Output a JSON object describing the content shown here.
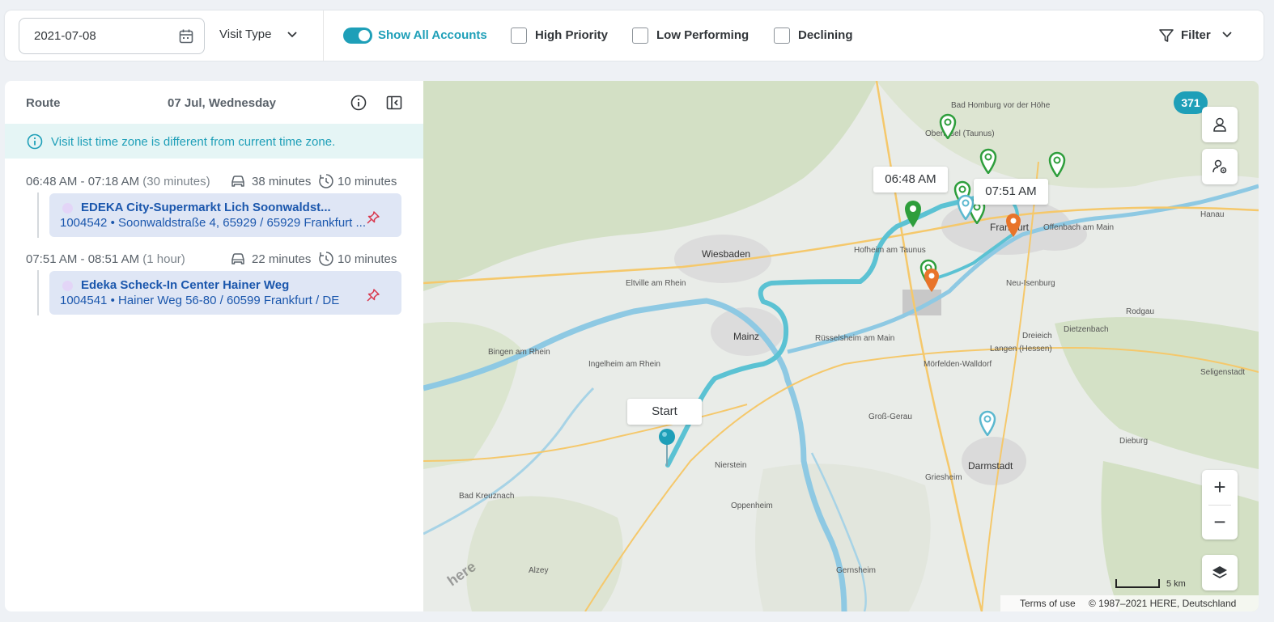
{
  "toolbar": {
    "date_value": "2021-07-08",
    "visit_type_label": "Visit Type",
    "show_all_accounts_label": "Show All Accounts",
    "show_all_accounts_on": true,
    "high_priority_label": "High Priority",
    "low_performing_label": "Low Performing",
    "declining_label": "Declining",
    "filter_label": "Filter"
  },
  "panel": {
    "route_label": "Route",
    "route_date": "07 Jul, Wednesday",
    "timezone_notice": "Visit list time zone is different from current time zone.",
    "visits": [
      {
        "time_range": "06:48 AM - 07:18 AM",
        "duration": "(30 minutes)",
        "drive_time": "38 minutes",
        "break_time": "10 minutes",
        "name": "EDEKA City-Supermarkt Lich Soonwaldst...",
        "id": "1004542",
        "address": "Soonwaldstraße 4, 65929 / 65929 Frankfurt ..."
      },
      {
        "time_range": "07:51 AM - 08:51 AM",
        "duration": "(1 hour)",
        "drive_time": "22 minutes",
        "break_time": "10 minutes",
        "name": "Edeka Scheck-In Center Hainer Weg",
        "id": "1004541",
        "address": "Hainer Weg 56-80 / 60599 Frankfurt / DE"
      }
    ]
  },
  "map": {
    "account_count": "371",
    "start_label": "Start",
    "callout_1": "06:48 AM",
    "callout_2": "07:51 AM",
    "zoom_in": "+",
    "zoom_out": "−",
    "scale_label": "5 km",
    "terms": "Terms of use",
    "copyright": "© 1987–2021 HERE, Deutschland",
    "watermark": "here",
    "places": {
      "wiesbaden": "Wiesbaden",
      "mainz": "Mainz",
      "frankfurt": "Frankfurt",
      "darmstadt": "Darmstadt",
      "offenbach": "Offenbach am Main",
      "rodgau": "Rodgau",
      "langen": "Langen (Hessen)",
      "bad_homburg": "Bad Homburg vor der Höhe",
      "dietzenbach": "Dietzenbach",
      "ruesselsheim": "Rüsselsheim am Main",
      "bad_kreuznach": "Bad Kreuznach",
      "ingelheim": "Ingelheim am Rhein",
      "hofheim": "Hofheim am Taunus",
      "neu_isenburg": "Neu-Isenburg",
      "dreieich": "Dreieich",
      "moerfelden": "Mörfelden-Walldorf",
      "gross_gerau": "Groß-Gerau",
      "griesheim": "Griesheim",
      "seligenstadt": "Seligenstadt",
      "eltville": "Eltville am Rhein",
      "bingen": "Bingen am Rhein",
      "oberursel": "Oberursel (Taunus)",
      "hanau": "Hanau",
      "dieburg": "Dieburg",
      "nierstein": "Nierstein",
      "oppenheim": "Oppenheim",
      "gernsheim": "Gernsheim",
      "alzey": "Alzey"
    }
  },
  "colors": {
    "accent": "#1e9fb8",
    "link": "#1b57ad",
    "route": "#5bc2d3",
    "pin_green": "#2e9e3c",
    "pin_orange": "#e8742a",
    "pin_blue": "#5bb8cf",
    "alert_red": "#d9364c"
  },
  "icons": [
    "calendar-icon",
    "chevron-down-icon",
    "filter-icon",
    "info-icon",
    "collapse-panel-icon",
    "car-icon",
    "clock-icon",
    "pin-icon",
    "person-icon",
    "person-settings-icon",
    "layers-icon"
  ]
}
